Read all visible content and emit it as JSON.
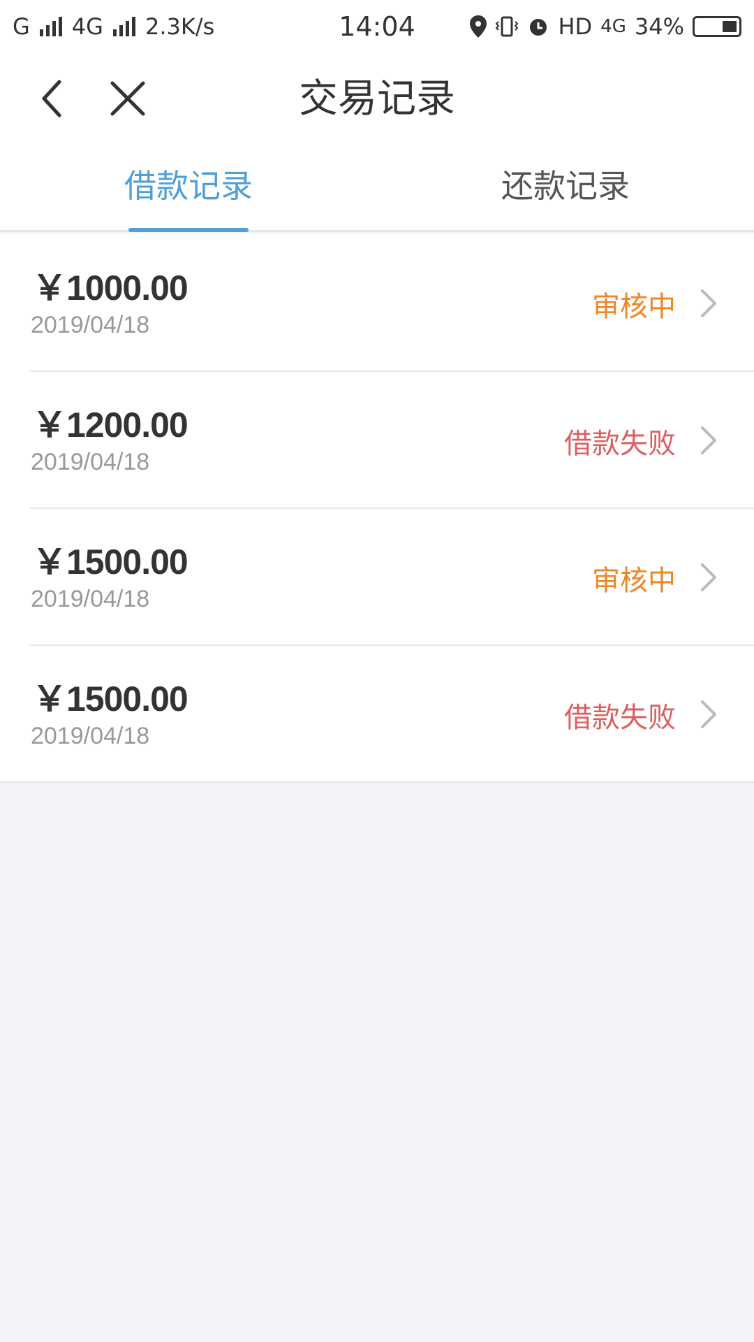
{
  "status_bar": {
    "carrier1": "G",
    "carrier2": "4G",
    "speed": "2.3K/s",
    "time": "14:04",
    "hd": "HD",
    "net": "4G",
    "battery": "34%"
  },
  "nav": {
    "title": "交易记录",
    "back_icon": "chevron-left-icon",
    "close_icon": "close-icon"
  },
  "tabs": [
    {
      "label": "借款记录",
      "active": true
    },
    {
      "label": "还款记录",
      "active": false
    }
  ],
  "colors": {
    "accent": "#4f9fd9",
    "pending": "#ef8626",
    "failed": "#dc5f5f",
    "background": "#f2f2f7"
  },
  "records": [
    {
      "amount": "￥1000.00",
      "date": "2019/04/18",
      "status": "审核中"
    },
    {
      "amount": "￥1200.00",
      "date": "2019/04/18",
      "status": "借款失败"
    },
    {
      "amount": "￥1500.00",
      "date": "2019/04/18",
      "status": "审核中"
    },
    {
      "amount": "￥1500.00",
      "date": "2019/04/18",
      "status": "借款失败"
    }
  ]
}
